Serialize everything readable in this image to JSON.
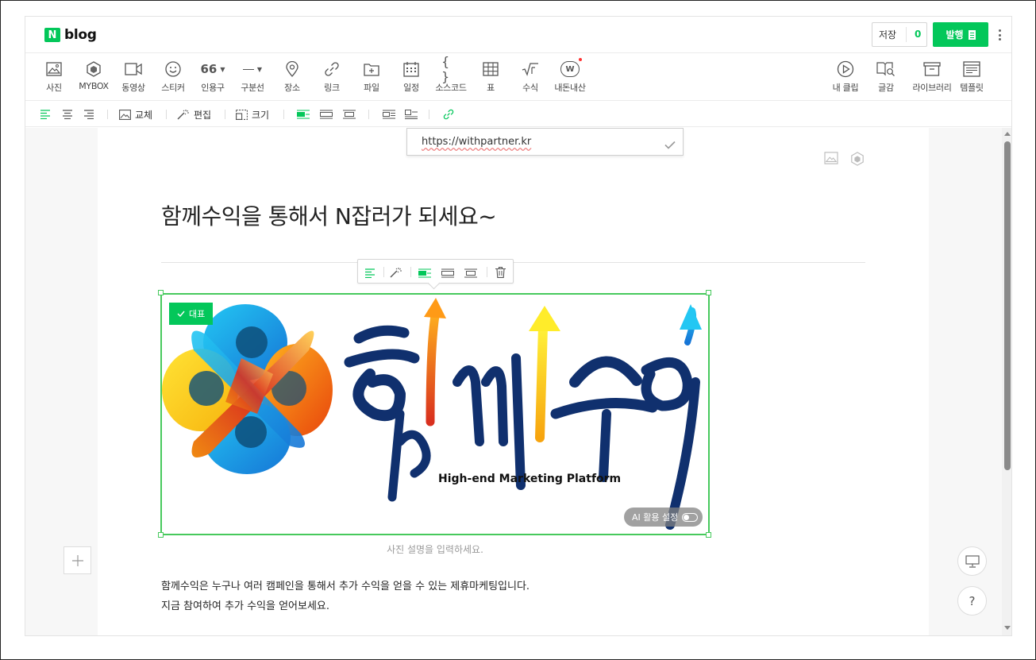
{
  "app": {
    "logo_mark": "N",
    "logo_text": "blog"
  },
  "header": {
    "save_label": "저장",
    "save_count": "0",
    "publish_label": "발행"
  },
  "toolbar": {
    "left": [
      {
        "label": "사진",
        "icon": "photo-icon"
      },
      {
        "label": "MYBOX",
        "icon": "mybox-icon"
      },
      {
        "label": "동영상",
        "icon": "video-icon"
      },
      {
        "label": "스티커",
        "icon": "sticker-icon"
      },
      {
        "label": "인용구",
        "icon": "quote-icon"
      },
      {
        "label": "구분선",
        "icon": "divider-icon"
      },
      {
        "label": "장소",
        "icon": "place-icon"
      },
      {
        "label": "링크",
        "icon": "link-icon"
      },
      {
        "label": "파일",
        "icon": "file-icon"
      },
      {
        "label": "일정",
        "icon": "calendar-icon"
      },
      {
        "label": "소스코드",
        "icon": "source-code-icon"
      },
      {
        "label": "표",
        "icon": "table-icon"
      },
      {
        "label": "수식",
        "icon": "formula-icon"
      },
      {
        "label": "내돈내산",
        "icon": "my-money-icon"
      }
    ],
    "quote_glyph": "66",
    "code_glyph": "{ }",
    "my_money_glyph": "W",
    "right": [
      {
        "label": "내 클립",
        "icon": "clip-icon"
      },
      {
        "label": "글감",
        "icon": "material-icon"
      },
      {
        "label": "라이브러리",
        "icon": "library-icon"
      },
      {
        "label": "템플릿",
        "icon": "template-icon"
      }
    ]
  },
  "format_bar": {
    "replace_label": "교체",
    "edit_label": "편집",
    "size_label": "크기"
  },
  "link_popup": {
    "url": "https://withpartner.kr"
  },
  "post": {
    "title": "함께수익을 통해서 N잡러가 되세요~",
    "image": {
      "representative_label": "대표",
      "brand_text": "함께수익",
      "tagline": "High-end Marketing Platform",
      "ai_toggle_label": "AI 활용 설정"
    },
    "caption_placeholder": "사진 설명을 입력하세요.",
    "body_lines": [
      "함께수익은 누구나 여러 캠페인을 통해서 추가 수익을 얻을 수 있는 제휴마케팅입니다.",
      "지금 참여하여 추가 수익을 얻어보세요."
    ]
  },
  "float_buttons": {
    "help_label": "?"
  },
  "colors": {
    "brand_green": "#03c75a",
    "selection_green": "#47c95d",
    "logo_navy": "#1a2f6e"
  }
}
